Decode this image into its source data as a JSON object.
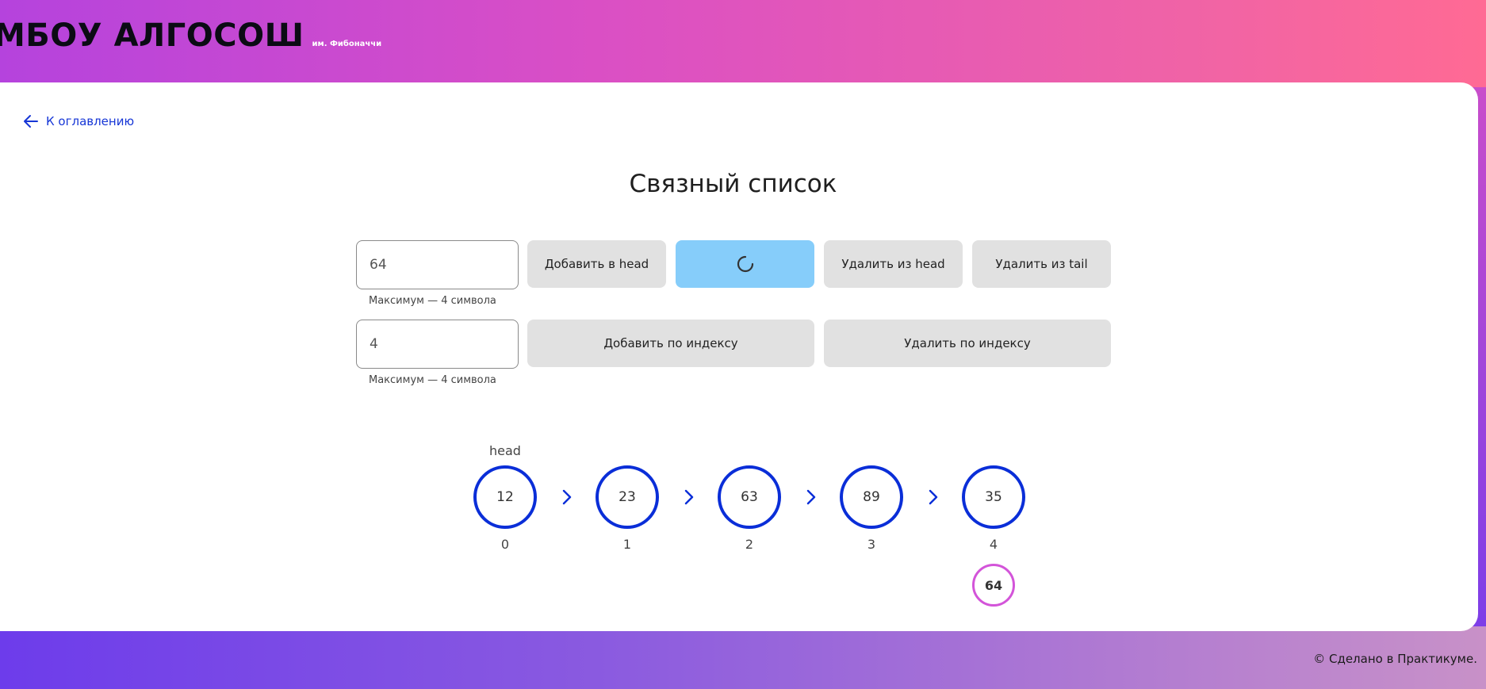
{
  "brand": {
    "title": "МБОУ АЛГОСОШ",
    "subtitle": "им. Фибоначчи"
  },
  "nav": {
    "back_label": "К оглавлению",
    "back_icon": "arrow-left-icon"
  },
  "page": {
    "title": "Связный список"
  },
  "controls": {
    "value_input": {
      "value": "64",
      "hint": "Максимум — 4 символа"
    },
    "index_input": {
      "value": "4",
      "hint": "Максимум — 4 символа"
    },
    "buttons": {
      "add_head": "Добавить в head",
      "add_tail_loading": "",
      "remove_head": "Удалить из head",
      "remove_tail": "Удалить из tail",
      "add_by_index": "Добавить по индексу",
      "remove_by_index": "Удалить по индексу"
    }
  },
  "list": {
    "head_label": "head",
    "nodes": [
      {
        "value": "12",
        "index": "0"
      },
      {
        "value": "23",
        "index": "1"
      },
      {
        "value": "63",
        "index": "2"
      },
      {
        "value": "89",
        "index": "3"
      },
      {
        "value": "35",
        "index": "4"
      }
    ],
    "pending_node": {
      "value": "64"
    }
  },
  "colors": {
    "node_border": "#0a2ed8",
    "pending_border": "#d354d9",
    "active_button": "#86cdfa",
    "link": "#1636d6"
  },
  "footer": {
    "text": "© Сделано в Практикуме."
  }
}
